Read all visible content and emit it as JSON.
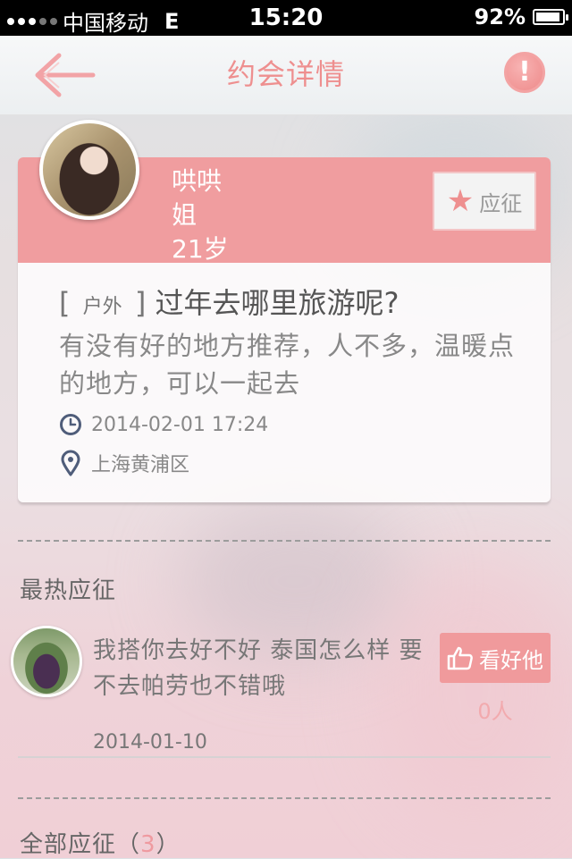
{
  "status_bar": {
    "carrier": "中国移动",
    "network": "E",
    "time": "15:20",
    "battery": "92%",
    "battery_level": 0.92
  },
  "nav": {
    "title": "约会详情",
    "back_icon": "back-arrow-icon",
    "report_icon": "alert-icon",
    "report_symbol": "!"
  },
  "date_card": {
    "user": {
      "name_line1": "哄哄",
      "name_line2": "姐",
      "age": "21岁"
    },
    "apply_button": {
      "label": "应征",
      "icon": "star-icon"
    },
    "category": "户外",
    "bracket_open": "[",
    "bracket_close": "]",
    "title": "过年去哪里旅游呢?",
    "description": "有没有好的地方推荐，人不多，温暖点的地方，可以一起去",
    "datetime": "2014-02-01 17:24",
    "location": "上海黄浦区"
  },
  "hot_section": {
    "title": "最热应征",
    "reply": {
      "text": "我搭你去好不好  泰国怎么样  要不去帕劳也不错哦",
      "date": "2014-01-10",
      "like_label": "看好他",
      "like_count": "0人"
    }
  },
  "all_section": {
    "title_prefix": "全部应征（",
    "count": "3",
    "title_suffix": "）"
  },
  "colors": {
    "accent": "#f09d9f",
    "title_pink": "#ee8f8f"
  }
}
